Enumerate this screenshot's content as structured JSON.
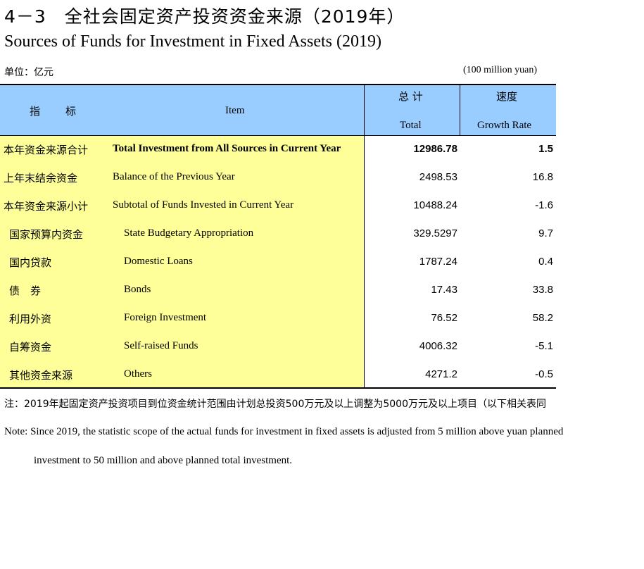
{
  "title_cn": "4－3　全社会固定资产投资资金来源（2019年）",
  "title_en": "Sources of Funds for Investment in Fixed Assets (2019)",
  "unit_cn": "单位：亿元",
  "unit_en": "(100 million yuan)",
  "header": {
    "indicator_cn": "指　　标",
    "item_en": "Item",
    "total_cn": "总 计",
    "total_en": "Total",
    "growth_cn": "速度",
    "growth_en": "Growth Rate"
  },
  "rows": [
    {
      "cn": "本年资金来源合计",
      "en": "Total Investment from All Sources in Current Year",
      "total": "12986.78",
      "growth": "1.5",
      "bold": true,
      "indent": false
    },
    {
      "cn": "上年末结余资金",
      "en": "Balance of the Previous Year",
      "total": "2498.53",
      "growth": "16.8",
      "bold": false,
      "indent": false
    },
    {
      "cn": "本年资金来源小计",
      "en": "Subtotal of Funds Invested in Current Year",
      "total": "10488.24",
      "growth": "-1.6",
      "bold": false,
      "indent": false
    },
    {
      "cn": "国家预算内资金",
      "en": "State Budgetary Appropriation",
      "total": "329.5297",
      "growth": "9.7",
      "bold": false,
      "indent": true
    },
    {
      "cn": "国内贷款",
      "en": "Domestic Loans",
      "total": "1787.24",
      "growth": "0.4",
      "bold": false,
      "indent": true
    },
    {
      "cn": "债　券",
      "en": "Bonds",
      "total": "17.43",
      "growth": "33.8",
      "bold": false,
      "indent": true
    },
    {
      "cn": "利用外资",
      "en": "Foreign Investment",
      "total": "76.52",
      "growth": "58.2",
      "bold": false,
      "indent": true
    },
    {
      "cn": "自筹资金",
      "en": "Self-raised Funds",
      "total": "4006.32",
      "growth": "-5.1",
      "bold": false,
      "indent": true
    },
    {
      "cn": "其他资金来源",
      "en": "Others",
      "total": "4271.2",
      "growth": "-0.5",
      "bold": false,
      "indent": true
    }
  ],
  "note_cn": "注：2019年起固定资产投资项目到位资金统计范围由计划总投资500万元及以上调整为5000万元及以上项目（以下相关表同",
  "note_en_line1": "Note: Since 2019, the statistic scope of the actual funds for investment in fixed assets is adjusted from 5 million above yuan planned",
  "note_en_line2": "investment to 50 million and above planned total investment."
}
